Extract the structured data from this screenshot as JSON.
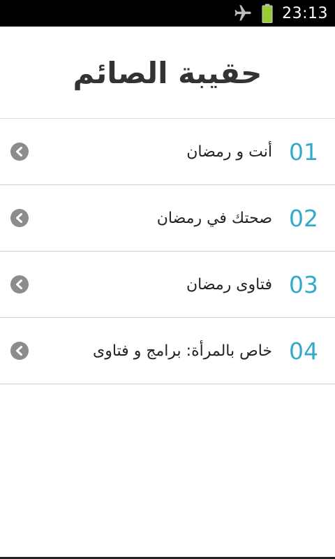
{
  "status_bar": {
    "time": "23:13",
    "icons": [
      "airplane-mode-icon",
      "battery-icon"
    ],
    "battery_color": "#99cc33"
  },
  "header": {
    "title": "حقيبة الصائم"
  },
  "menu": {
    "accent_color": "#33aacc",
    "items": [
      {
        "number": "01",
        "label": "أنت و رمضان",
        "icon": "chevron-left-icon"
      },
      {
        "number": "02",
        "label": "صحتك في رمضان",
        "icon": "chevron-left-icon"
      },
      {
        "number": "03",
        "label": "فتاوى رمضان",
        "icon": "chevron-left-icon"
      },
      {
        "number": "04",
        "label": "خاص بالمرأة: برامج و فتاوى",
        "icon": "chevron-left-icon"
      }
    ]
  }
}
